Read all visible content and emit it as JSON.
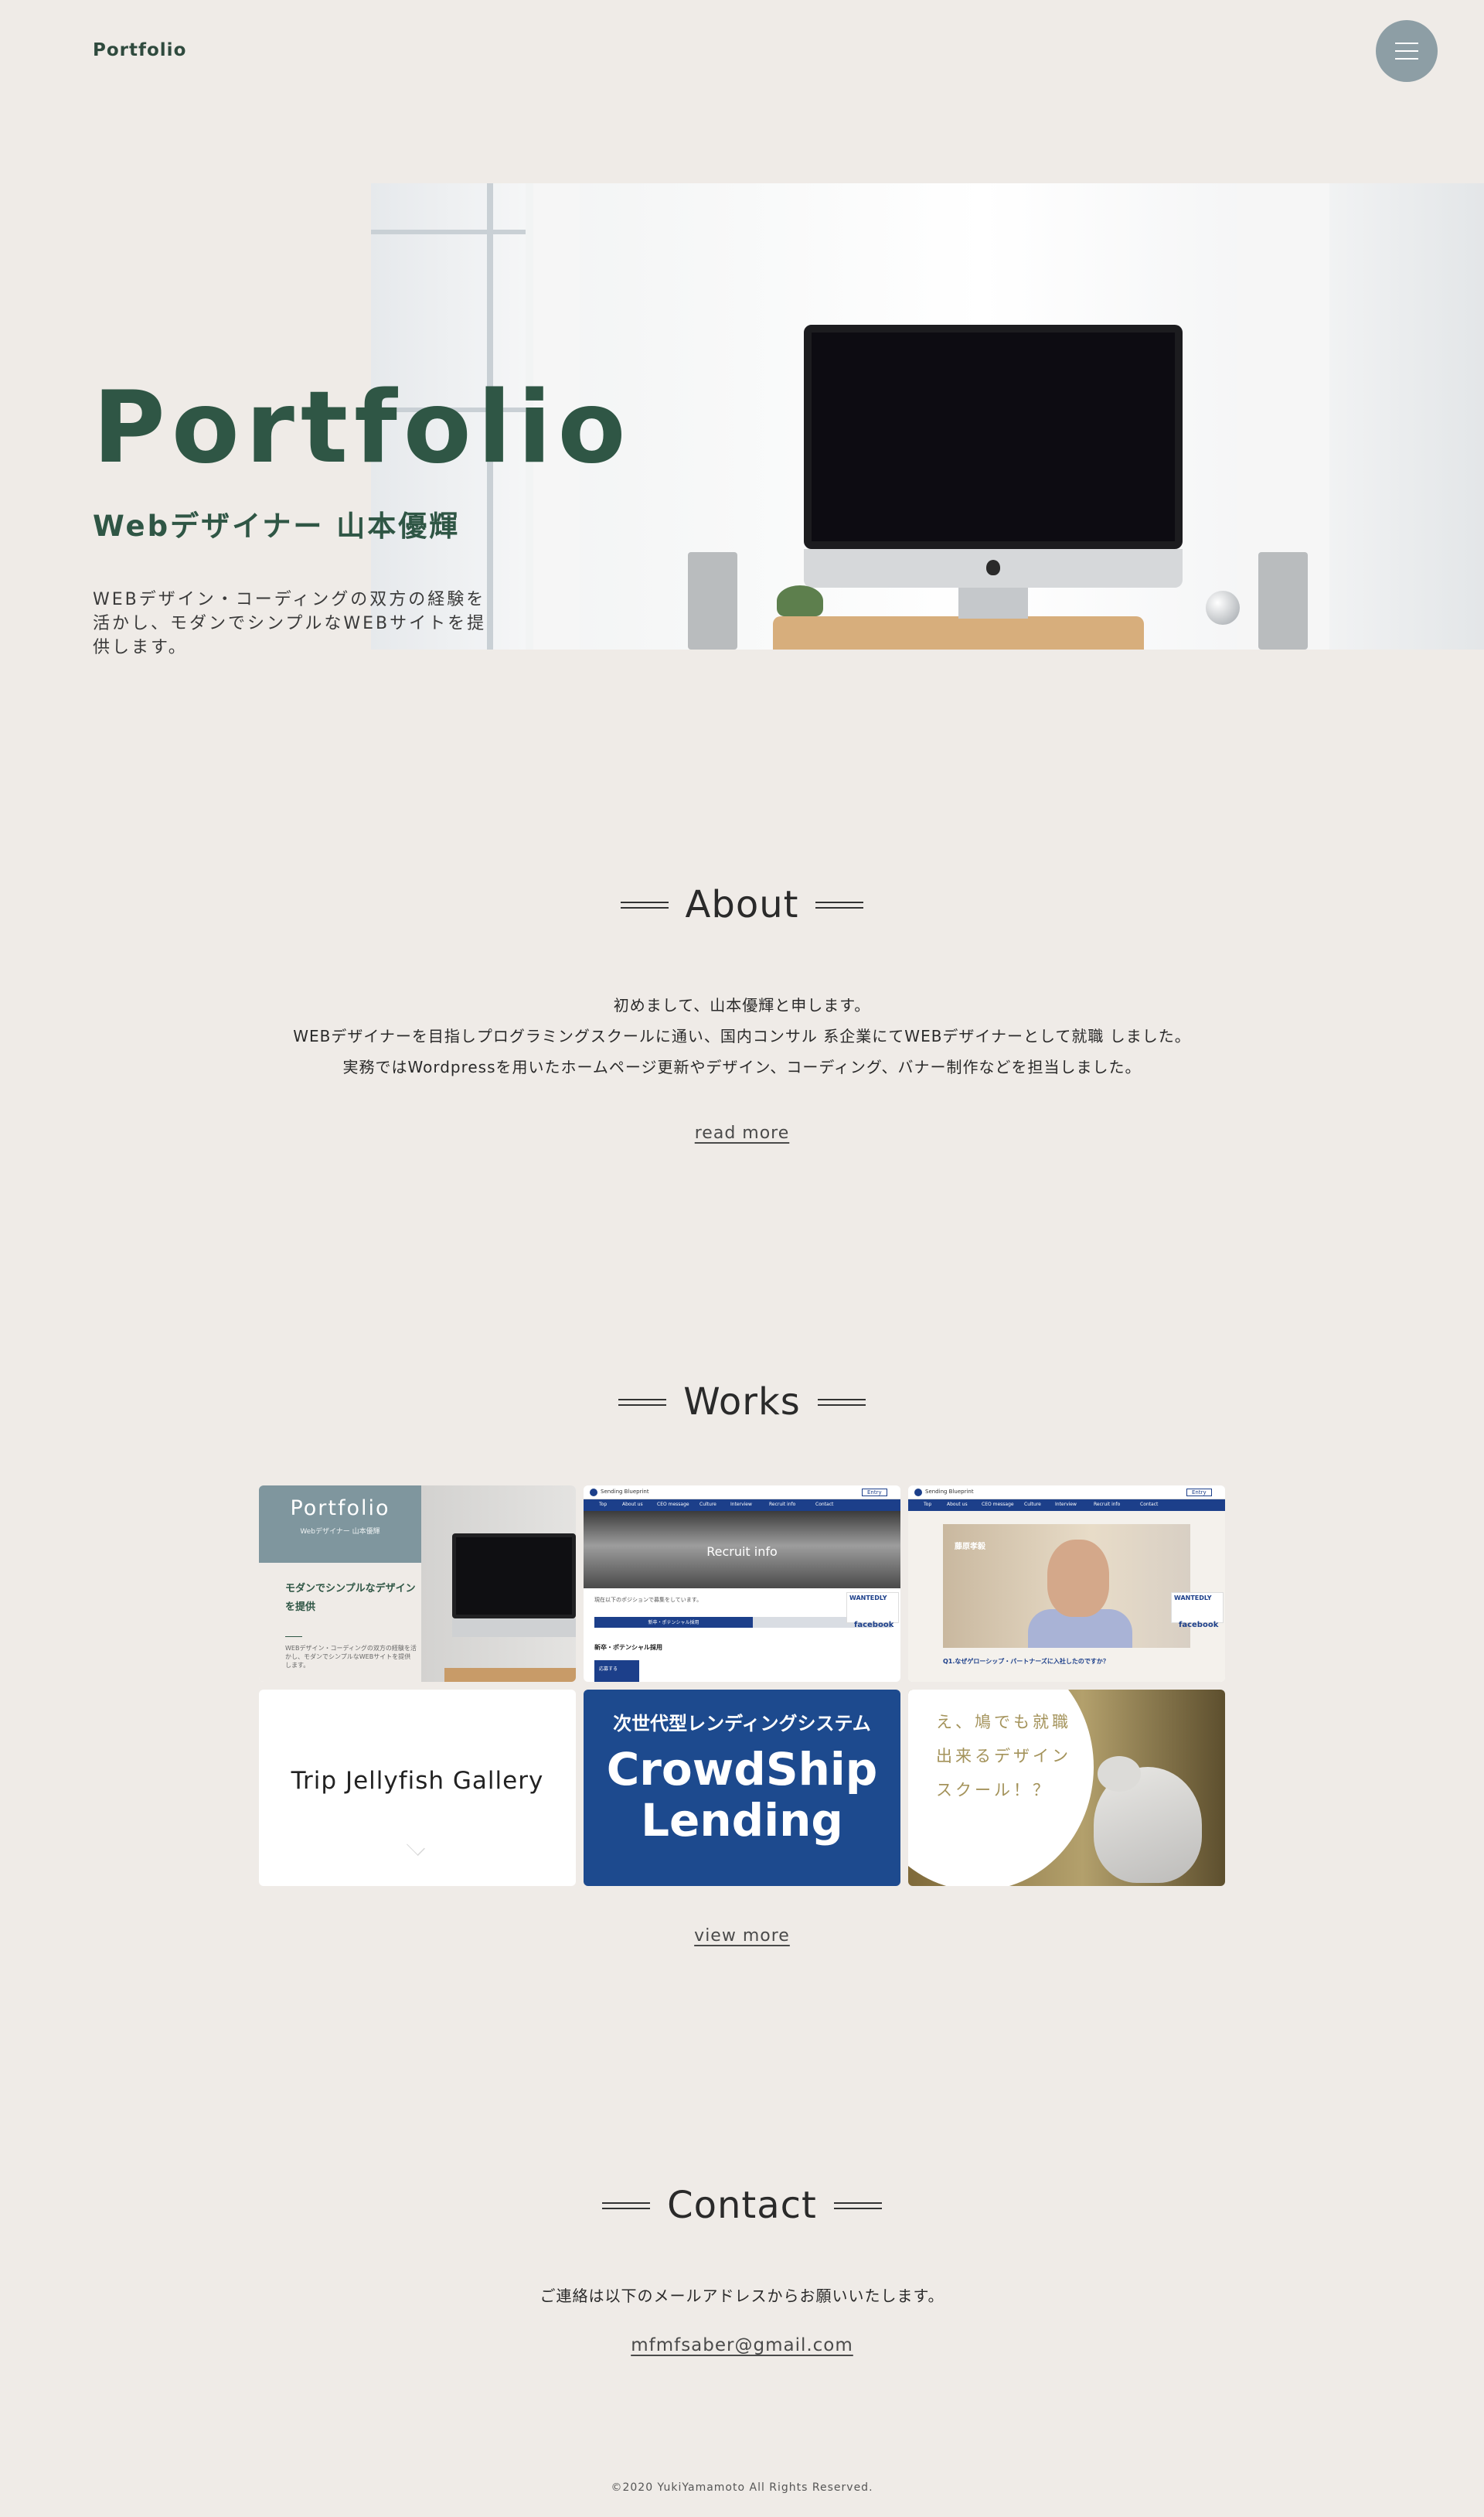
{
  "header": {
    "logo": "Portfolio",
    "menu_icon": "hamburger-icon"
  },
  "hero": {
    "title": "Portfolio",
    "subtitle": "Webデザイナー 山本優輝",
    "description": "WEBデザイン・コーディングの双方の経験を活かし、モダンでシンプルなWEBサイトを提供します。"
  },
  "about": {
    "heading": "About",
    "lines": [
      "初めまして、山本優輝と申します。",
      "WEBデザイナーを目指しプログラミングスクールに通い、国内コンサル 系企業にてWEBデザイナーとして就職 しました。",
      "実務ではWordpressを用いたホームページ更新やデザイン、コーディング、バナー制作などを担当しました。"
    ],
    "link": "read more"
  },
  "works": {
    "heading": "Works",
    "items": [
      {
        "title": "Portfolio",
        "subtitle": "Webデザイナー 山本優輝",
        "catch": "モダンでシンプルなデザインを提供",
        "desc": "WEBデザイン・コーディングの双方の経験を活かし、モダンでシンプルなWEBサイトを提供します。"
      },
      {
        "site_name": "Sending Blueprint",
        "entry": "Entry",
        "nav": [
          "Top",
          "About us",
          "CEO message",
          "Culture",
          "Interview",
          "Recruit info",
          "Contact"
        ],
        "hero_label": "Recruit info",
        "text": "現在以下のポジションで募集をしています。",
        "bar_label": "新卒・ポテンシャル採用",
        "heading": "新卒・ポテンシャル採用",
        "button": "応募する",
        "badge": "WANTEDLY",
        "fb": "facebook"
      },
      {
        "site_name": "Sending Blueprint",
        "entry": "Entry",
        "nav": [
          "Top",
          "About us",
          "CEO message",
          "Culture",
          "Interview",
          "Recruit info",
          "Contact"
        ],
        "name": "藤原孝毅",
        "question": "Q1.なぜゲローシップ・パートナーズに入社したのですか？",
        "badge": "WANTEDLY",
        "fb": "facebook"
      },
      {
        "title": "Trip Jellyfish Gallery",
        "icon": "chevron-down-icon"
      },
      {
        "kicker": "次世代型レンディングシステム",
        "title_line1": "CrowdShip",
        "title_line2": "Lending"
      },
      {
        "text": "え、鳩でも就職出来るデザインスクール！？"
      }
    ],
    "link": "view more"
  },
  "contact": {
    "heading": "Contact",
    "text": "ご連絡は以下のメールアドレスからお願いいたします。",
    "email": "mfmfsaber@gmail.com"
  },
  "footer": {
    "copyright": "©2020 YukiYamamoto All Rights Reserved."
  }
}
